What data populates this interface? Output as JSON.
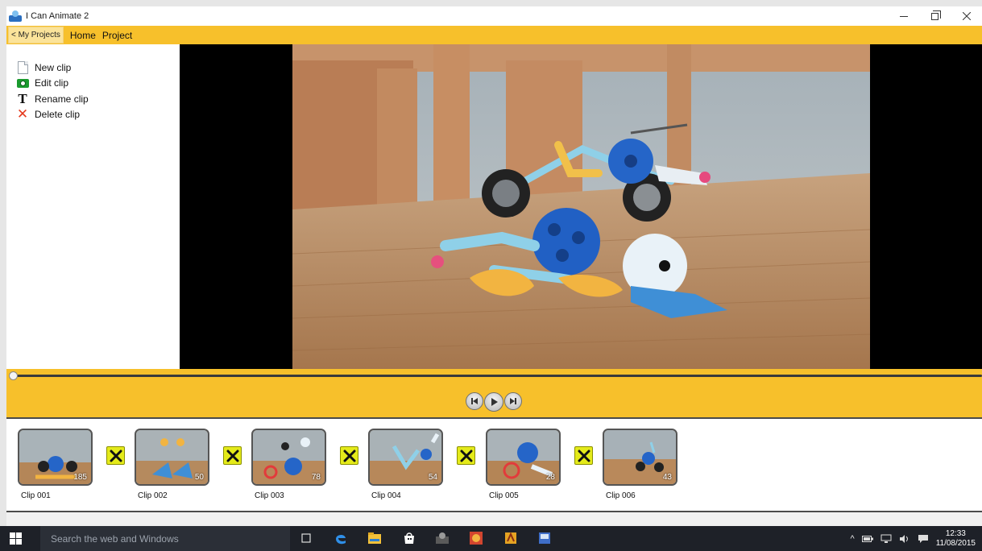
{
  "window": {
    "title": "I Can Animate 2"
  },
  "menu": {
    "back_label": "< My Projects",
    "items": [
      "Home",
      "Project"
    ]
  },
  "actions": [
    {
      "label": "New clip",
      "icon": "new-document-icon"
    },
    {
      "label": "Edit clip",
      "icon": "camera-icon"
    },
    {
      "label": "Rename clip",
      "icon": "text-icon"
    },
    {
      "label": "Delete clip",
      "icon": "delete-x-icon"
    }
  ],
  "playback": {
    "position": 0,
    "buttons": [
      "previous-frame",
      "play",
      "next-frame"
    ]
  },
  "clips": [
    {
      "label": "Clip 001",
      "count": "185"
    },
    {
      "label": "Clip 002",
      "count": "50"
    },
    {
      "label": "Clip 003",
      "count": "78"
    },
    {
      "label": "Clip 004",
      "count": "54"
    },
    {
      "label": "Clip 005",
      "count": "28"
    },
    {
      "label": "Clip 006",
      "count": "43"
    }
  ],
  "taskbar": {
    "search_placeholder": "Search the web and Windows",
    "time": "12:33",
    "date": "11/08/2015"
  },
  "colors": {
    "accent": "#f7c02b",
    "transition": "#e4ea1a",
    "taskbar": "#1e2128"
  }
}
